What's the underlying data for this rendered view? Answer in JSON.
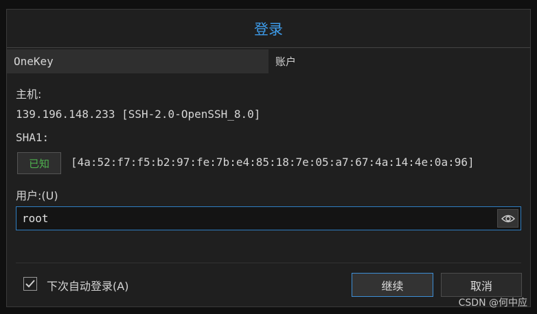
{
  "dialog": {
    "title": "登录",
    "tabs": {
      "active": "OneKey",
      "account": "账户"
    },
    "host_label": "主机:",
    "host_value": "139.196.148.233 [SSH-2.0-OpenSSH_8.0]",
    "sha1_label": "SHA1:",
    "known_button": "已知",
    "fingerprint": "[4a:52:f7:f5:b2:97:fe:7b:e4:85:18:7e:05:a7:67:4a:14:4e:0a:96]",
    "user_label": "用户:(U)",
    "user_value": "root",
    "remember_label": "下次自动登录(A)",
    "remember_checked": true,
    "continue_label": "继续",
    "cancel_label": "取消"
  },
  "watermark": "CSDN @何中应",
  "colors": {
    "accent": "#3d9be9",
    "known": "#4fb24f",
    "focus": "#2f7fc4"
  }
}
